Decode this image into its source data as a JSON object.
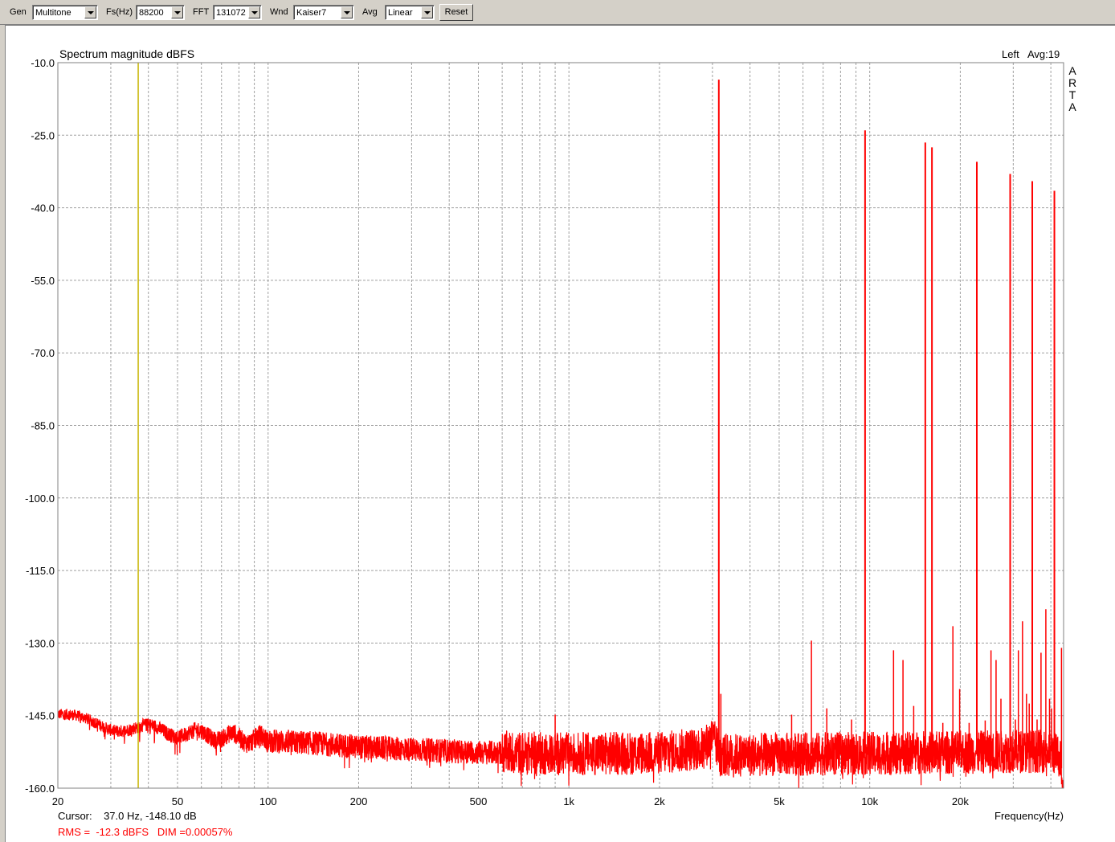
{
  "toolbar": {
    "gen_label": "Gen",
    "gen_value": "Multitone",
    "fs_label": "Fs(Hz)",
    "fs_value": "88200",
    "fft_label": "FFT",
    "fft_value": "131072",
    "wnd_label": "Wnd",
    "wnd_value": "Kaiser7",
    "avg_label": "Avg",
    "avg_value": "Linear",
    "reset_label": "Reset"
  },
  "colors": {
    "trace": "#ff0000",
    "cursor": "#c8b400",
    "grid": "#a0a0a0"
  },
  "chart_data": {
    "type": "line",
    "title": "Spectrum magnitude dBFS",
    "channel": "Left",
    "avg_text": "Avg:19",
    "brand": [
      "A",
      "R",
      "T",
      "A"
    ],
    "xlabel": "Frequency(Hz)",
    "ylabel": "",
    "x_scale": "log",
    "xlim": [
      20,
      44100
    ],
    "ylim": [
      -160,
      -10
    ],
    "grid": true,
    "y_ticks": [
      "-10.0",
      "-25.0",
      "-40.0",
      "-55.0",
      "-70.0",
      "-85.0",
      "-100.0",
      "-115.0",
      "-130.0",
      "-145.0",
      "-160.0"
    ],
    "x_ticks": [
      {
        "value": 20,
        "label": "20"
      },
      {
        "value": 50,
        "label": "50"
      },
      {
        "value": 100,
        "label": "100"
      },
      {
        "value": 200,
        "label": "200"
      },
      {
        "value": 500,
        "label": "500"
      },
      {
        "value": 1000,
        "label": "1k"
      },
      {
        "value": 2000,
        "label": "2k"
      },
      {
        "value": 5000,
        "label": "5k"
      },
      {
        "value": 10000,
        "label": "10k"
      },
      {
        "value": 20000,
        "label": "20k"
      }
    ],
    "cursor_freq": 37.0,
    "cursor_text": "Cursor:    37.0 Hz, -148.10 dB",
    "rms_text": "RMS =  -12.3 dBFS   DIM =0.00057%",
    "noise_floor": [
      [
        20,
        -145.3
      ],
      [
        24,
        -146.0
      ],
      [
        30,
        -147.2
      ],
      [
        40,
        -147.8
      ],
      [
        50,
        -148.5
      ],
      [
        70,
        -149.3
      ],
      [
        100,
        -150.2
      ],
      [
        150,
        -150.8
      ],
      [
        200,
        -151.5
      ],
      [
        300,
        -152.0
      ],
      [
        500,
        -152.6
      ],
      [
        1000,
        -152.9
      ],
      [
        2000,
        -152.7
      ],
      [
        2800,
        -151.8
      ],
      [
        3000,
        -149.5
      ],
      [
        3200,
        -153.2
      ],
      [
        5000,
        -153.0
      ],
      [
        10000,
        -152.8
      ],
      [
        20000,
        -152.6
      ],
      [
        40000,
        -152.3
      ],
      [
        43000,
        -153.5
      ],
      [
        44100,
        -160.0
      ]
    ],
    "tones": [
      {
        "freq": 3150,
        "level": -13.5
      },
      {
        "freq": 9650,
        "level": -24.0
      },
      {
        "freq": 15300,
        "level": -26.5
      },
      {
        "freq": 16100,
        "level": -27.5
      },
      {
        "freq": 22700,
        "level": -30.5
      },
      {
        "freq": 29300,
        "level": -33.0
      },
      {
        "freq": 34700,
        "level": -34.5
      },
      {
        "freq": 41100,
        "level": -36.5
      }
    ],
    "spurs": [
      {
        "freq": 900,
        "level": -144.8
      },
      {
        "freq": 3200,
        "level": -140.5
      },
      {
        "freq": 5500,
        "level": -144.8
      },
      {
        "freq": 6400,
        "level": -129.5
      },
      {
        "freq": 7200,
        "level": -143.5
      },
      {
        "freq": 8700,
        "level": -145.8
      },
      {
        "freq": 12000,
        "level": -131.5
      },
      {
        "freq": 12900,
        "level": -133.5
      },
      {
        "freq": 14000,
        "level": -143.0
      },
      {
        "freq": 17500,
        "level": -146.5
      },
      {
        "freq": 18900,
        "level": -126.5
      },
      {
        "freq": 19900,
        "level": -139.5
      },
      {
        "freq": 21400,
        "level": -146.5
      },
      {
        "freq": 24200,
        "level": -146.0
      },
      {
        "freq": 25300,
        "level": -131.5
      },
      {
        "freq": 26300,
        "level": -133.5
      },
      {
        "freq": 27300,
        "level": -141.5
      },
      {
        "freq": 30500,
        "level": -145.8
      },
      {
        "freq": 31200,
        "level": -131.5
      },
      {
        "freq": 32200,
        "level": -125.5
      },
      {
        "freq": 33200,
        "level": -140.5
      },
      {
        "freq": 33900,
        "level": -142.5
      },
      {
        "freq": 36000,
        "level": -145.8
      },
      {
        "freq": 37100,
        "level": -132.0
      },
      {
        "freq": 38500,
        "level": -123.0
      },
      {
        "freq": 39600,
        "level": -141.5
      },
      {
        "freq": 40200,
        "level": -143.5
      },
      {
        "freq": 43400,
        "level": -131.0
      }
    ]
  }
}
